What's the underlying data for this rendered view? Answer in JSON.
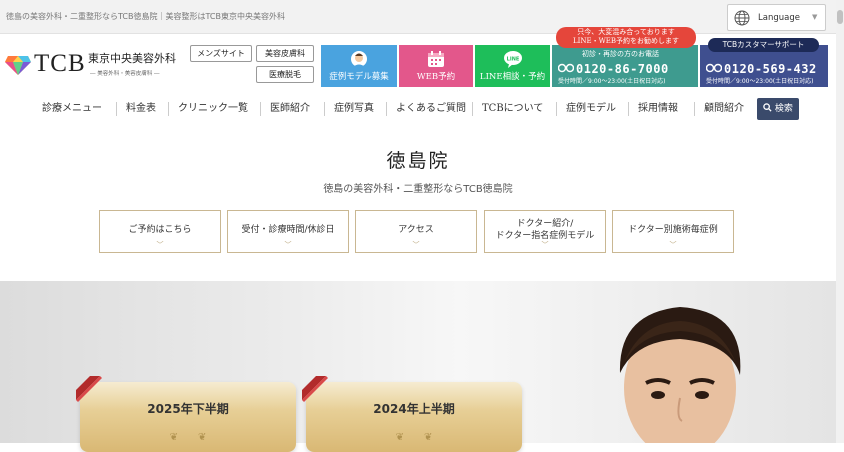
{
  "topbar": {
    "breadcrumb": "徳島の美容外科・二重整形ならTCB徳島院｜美容整形はTCB東京中央美容外科",
    "language_label": "Language"
  },
  "logo": {
    "brand": "TCB",
    "name_jp": "東京中央美容外科",
    "tagline": "― 美容外科・美容皮膚科 ―"
  },
  "header_buttons": {
    "mens": "メンズサイト",
    "skin": "美容皮膚科",
    "hair": "医療脱毛"
  },
  "tiles": [
    {
      "label": "症例モデル募集",
      "color": "#4aa3df",
      "icon": "doctor-icon"
    },
    {
      "label": "WEB予約",
      "color": "#e3578b",
      "icon": "calendar-icon"
    },
    {
      "label": "LINE相談・予約",
      "color": "#1ebe5a",
      "icon": "line-icon"
    }
  ],
  "promo": {
    "line1": "只今、大変混み合っております",
    "line2": "LINE・WEB予約をお勧めします"
  },
  "phone1": {
    "top": "初診・再診の方のお電話",
    "number": "0120-86-7000",
    "hours": "受付時間／9:00〜23:00(土日祝日対応)"
  },
  "phone2": {
    "support": "TCBカスタマーサポート",
    "number": "0120-569-432",
    "hours": "受付時間／9:00〜23:00(土日祝日対応)"
  },
  "nav": {
    "items": [
      "診療メニュー",
      "料金表",
      "クリニック一覧",
      "医師紹介",
      "症例写真",
      "よくあるご質問",
      "TCBについて",
      "症例モデル",
      "採用情報",
      "顧問紹介"
    ],
    "search": "検索"
  },
  "page": {
    "title": "徳島院",
    "subtitle": "徳島の美容外科・二重整形ならTCB徳島院"
  },
  "quick_links": [
    {
      "line1": "ご予約はこちら",
      "line2": ""
    },
    {
      "line1": "受付・診療時間/休診日",
      "line2": ""
    },
    {
      "line1": "アクセス",
      "line2": ""
    },
    {
      "line1": "ドクター紹介/",
      "line2": "ドクター指名症例モデル"
    },
    {
      "line1": "ドクター別施術毎症例",
      "line2": ""
    }
  ],
  "awards": [
    {
      "label": "2025年下半期"
    },
    {
      "label": "2024年上半期"
    }
  ],
  "colors": {
    "accent_navy": "#3a4a6b",
    "gold": "#c9b792"
  }
}
